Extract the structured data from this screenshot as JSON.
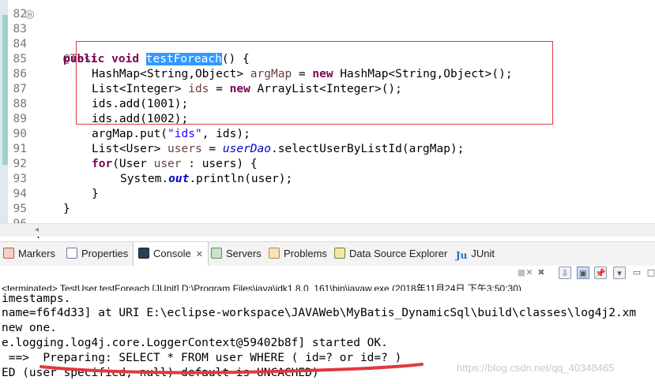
{
  "editor": {
    "lines": [
      {
        "n": "82",
        "fold": ""
      },
      {
        "n": "83",
        "fold": "⊖"
      },
      {
        "n": "84",
        "fold": ""
      },
      {
        "n": "85",
        "fold": ""
      },
      {
        "n": "86",
        "fold": ""
      },
      {
        "n": "87",
        "fold": ""
      },
      {
        "n": "88",
        "fold": ""
      },
      {
        "n": "89",
        "fold": ""
      },
      {
        "n": "90",
        "fold": ""
      },
      {
        "n": "91",
        "fold": ""
      },
      {
        "n": "92",
        "fold": ""
      },
      {
        "n": "93",
        "fold": ""
      },
      {
        "n": "94",
        "fold": ""
      },
      {
        "n": "95",
        "fold": ""
      },
      {
        "n": "96",
        "fold": ""
      }
    ],
    "code": {
      "l83_ann": "@Test",
      "l84_kw1": "public",
      "l84_kw2": "void",
      "l84_method": "testForeach",
      "l84_rest": "() {",
      "l85_a": "HashMap<String,Object> ",
      "l85_var": "argMap",
      "l85_b": " = ",
      "l85_kw": "new",
      "l85_c": " HashMap<String,Object>();",
      "l86_a": "List<Integer> ",
      "l86_var": "ids",
      "l86_b": " = ",
      "l86_kw": "new",
      "l86_c": " ArrayList<Integer>();",
      "l87": "ids.add(1001);",
      "l88": "ids.add(1002);",
      "l89_a": "argMap.put(",
      "l89_str": "\"ids\"",
      "l89_b": ", ids);",
      "l90_a": "List<User> ",
      "l90_var": "users",
      "l90_b": " = ",
      "l90_fld": "userDao",
      "l90_c": ".selectUserByListId(argMap);",
      "l91_kw": "for",
      "l91_a": "(User ",
      "l91_var": "user",
      "l91_b": " : users) {",
      "l92_a": "System.",
      "l92_fld": "out",
      "l92_b": ".println(user);",
      "l93": "}",
      "l94": "}",
      "l96": "}"
    }
  },
  "tabs": {
    "markers": "Markers",
    "properties": "Properties",
    "console": "Console",
    "console_close": "✕",
    "servers": "Servers",
    "problems": "Problems",
    "data_source_explorer": "Data Source Explorer",
    "junit_icon": "Ju",
    "junit": "JUnit"
  },
  "console_header": {
    "terminated": "<terminated> TestUser.testForeach [JUnit] D:\\Program Files\\java\\jdk1.8.0_161\\bin\\javaw.exe (2018年11月24日 下午3:50:30)"
  },
  "toolbar": {
    "stop": "■",
    "remove": "✕",
    "remove_all": "✖",
    "scroll_lock": "⇩",
    "pin": "📌",
    "display": "▣",
    "open_console": "▾",
    "minimize": "▭",
    "maximize": "□"
  },
  "console_output": [
    "imestamps.",
    "name=f6f4d33] at URI E:\\eclipse-workspace\\JAVAWeb\\MyBatis_DynamicSql\\build\\classes\\log4j2.xm",
    "new one.",
    "e.logging.log4j.core.LoggerContext@59402b8f] started OK.",
    " ==>  Preparing: SELECT * FROM user WHERE ( id=? or id=? )",
    "ED (user specified, null) default is UNCACHED)"
  ],
  "watermark": "https://blog.csdn.net/qq_40348465",
  "colors": {
    "keyword": "#7f0055",
    "string": "#2a00ff",
    "field": "#0000c0",
    "selection": "#3399ff",
    "annotation_red": "#e0393e"
  }
}
